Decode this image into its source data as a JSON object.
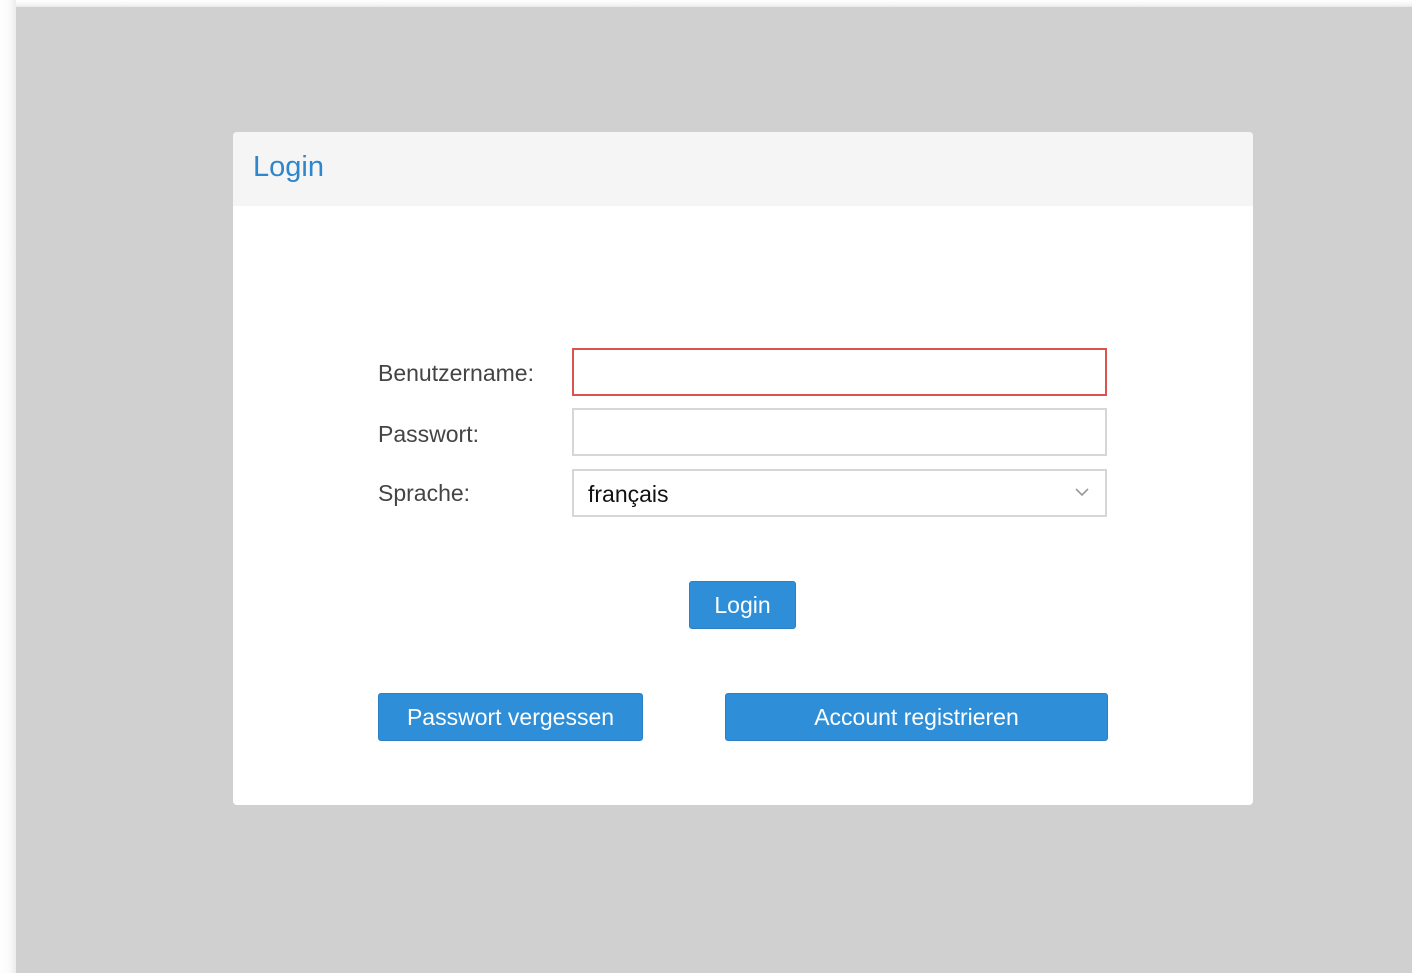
{
  "panel": {
    "title": "Login"
  },
  "form": {
    "username_label": "Benutzername:",
    "username_value": "",
    "password_label": "Passwort:",
    "password_value": "",
    "language_label": "Sprache:",
    "language_selected": "français"
  },
  "buttons": {
    "login_label": "Login",
    "forgot_password_label": "Passwort vergessen",
    "register_label": "Account registrieren"
  },
  "icons": {
    "select_arrow": "chevron-down-icon"
  },
  "colors": {
    "accent": "#2e8fd8",
    "title": "#2e86cc",
    "error_border": "#d9534f",
    "backdrop": "#d0d0d0"
  }
}
